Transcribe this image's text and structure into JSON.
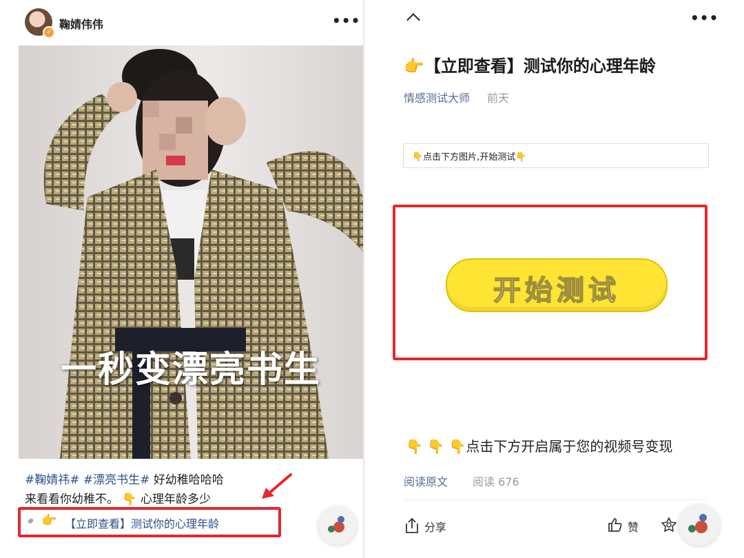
{
  "left": {
    "author": "鞠婧伟伟",
    "more": "•••",
    "video_caption": "一秒变漂亮书生",
    "post": {
      "tag1": "#鞠婧祎#",
      "tag2": "#漂亮书生#",
      "text1": "好幼稚哈哈哈",
      "text2": "来看看你幼稚不。",
      "pointer": "👇",
      "continuation": "心理年龄多少"
    },
    "link": {
      "pointer": "👉",
      "title": "【立即查看】测试你的心理年龄"
    }
  },
  "right": {
    "more": "•••",
    "title": "👉【立即查看】测试你的心理年龄",
    "author": "情感测试大师",
    "date": "前天",
    "hint": "👇点击下方图片,开始测试👇",
    "start_button": "开始测试",
    "promo": "👇 👇 👇点击下方开启属于您的视频号变现",
    "read_original": "阅读原文",
    "read_count": "阅读 676",
    "share": "分享",
    "like": "赞"
  },
  "colors": {
    "link_blue": "#576b95",
    "tag_blue": "#2d4f89",
    "highlight_red": "#e6262c",
    "button_yellow": "#ffe533"
  }
}
